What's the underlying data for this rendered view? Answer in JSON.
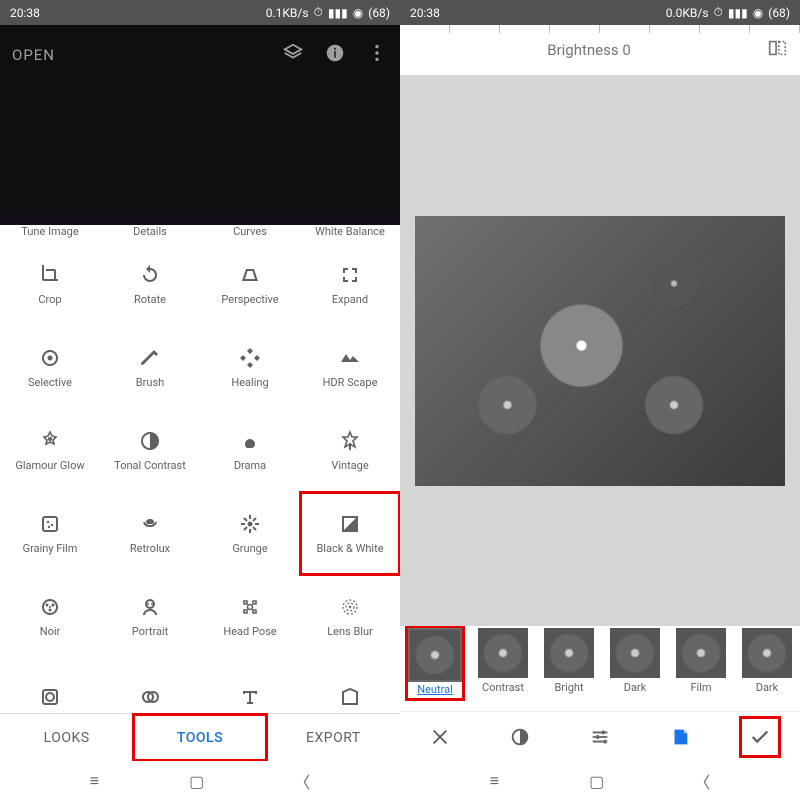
{
  "left": {
    "status": {
      "time": "20:38",
      "speed": "0.1KB/s",
      "battery": "68"
    },
    "open_label": "OPEN",
    "tools_row0": [
      "Tune Image",
      "Details",
      "Curves",
      "White Balance"
    ],
    "tools": [
      {
        "label": "Crop",
        "icon": "crop"
      },
      {
        "label": "Rotate",
        "icon": "rotate"
      },
      {
        "label": "Perspective",
        "icon": "perspective"
      },
      {
        "label": "Expand",
        "icon": "expand"
      },
      {
        "label": "Selective",
        "icon": "selective"
      },
      {
        "label": "Brush",
        "icon": "brush"
      },
      {
        "label": "Healing",
        "icon": "healing"
      },
      {
        "label": "HDR Scape",
        "icon": "hdr"
      },
      {
        "label": "Glamour Glow",
        "icon": "glow"
      },
      {
        "label": "Tonal Contrast",
        "icon": "tonal"
      },
      {
        "label": "Drama",
        "icon": "drama"
      },
      {
        "label": "Vintage",
        "icon": "vintage"
      },
      {
        "label": "Grainy Film",
        "icon": "grainy"
      },
      {
        "label": "Retrolux",
        "icon": "retrolux"
      },
      {
        "label": "Grunge",
        "icon": "grunge"
      },
      {
        "label": "Black & White",
        "icon": "bw",
        "highlight": true
      },
      {
        "label": "Noir",
        "icon": "noir"
      },
      {
        "label": "Portrait",
        "icon": "portrait"
      },
      {
        "label": "Head Pose",
        "icon": "headpose"
      },
      {
        "label": "Lens Blur",
        "icon": "lensblur"
      },
      {
        "label": "",
        "icon": "vignette"
      },
      {
        "label": "",
        "icon": "dexp"
      },
      {
        "label": "",
        "icon": "text"
      },
      {
        "label": "",
        "icon": "frame"
      }
    ],
    "tabs": {
      "looks": "LOOKS",
      "tools": "TOOLS",
      "export": "EXPORT"
    }
  },
  "right": {
    "status": {
      "time": "20:38",
      "speed": "0.0KB/s",
      "battery": "68"
    },
    "adjust_label": "Brightness 0",
    "presets": [
      {
        "label": "Neutral",
        "selected": true,
        "highlight": true
      },
      {
        "label": "Contrast"
      },
      {
        "label": "Bright"
      },
      {
        "label": "Dark"
      },
      {
        "label": "Film"
      },
      {
        "label": "Dark"
      }
    ]
  }
}
